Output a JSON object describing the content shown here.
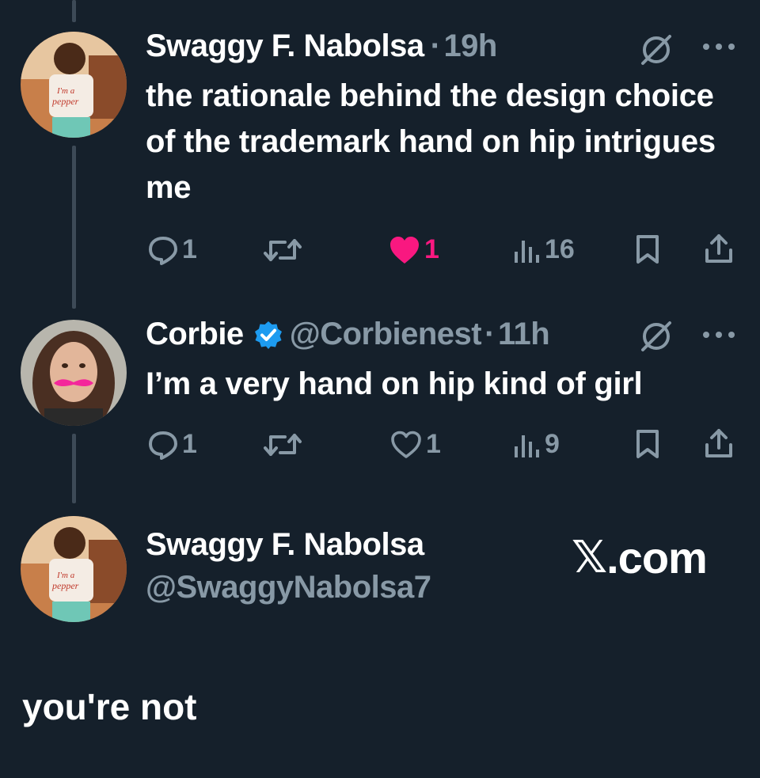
{
  "tweets": [
    {
      "name": "Swaggy F. Nabolsa",
      "separator": "·",
      "time": "19h",
      "text": "the rationale behind the design choice of the trademark hand on hip intrigues me",
      "actions": {
        "replies": "1",
        "retweets": "",
        "likes": "1",
        "views": "16"
      },
      "liked": true,
      "avatar_icon": "avatar-swaggy"
    },
    {
      "name": "Corbie",
      "handle": "@Corbienest",
      "separator": "·",
      "time": "11h",
      "text": "I’m a very hand on hip kind of girl",
      "actions": {
        "replies": "1",
        "retweets": "",
        "likes": "1",
        "views": "9"
      },
      "liked": false,
      "verified": true,
      "avatar_icon": "avatar-corbie"
    }
  ],
  "quoted_author": {
    "name": "Swaggy F. Nabolsa",
    "handle": "@SwaggyNabolsa7"
  },
  "watermark": {
    "logo": "𝕏",
    "suffix": ".com"
  },
  "reply_text": "you're not",
  "colors": {
    "background": "#15202b",
    "muted": "#8899a6",
    "like_pink": "#f91880",
    "verified_blue": "#1d9bf0",
    "thread_line": "#3d4a57"
  },
  "icons": [
    "grok-icon",
    "more-icon",
    "reply-icon",
    "retweet-icon",
    "heart-icon",
    "views-icon",
    "bookmark-icon",
    "share-icon",
    "verified-badge-icon"
  ]
}
